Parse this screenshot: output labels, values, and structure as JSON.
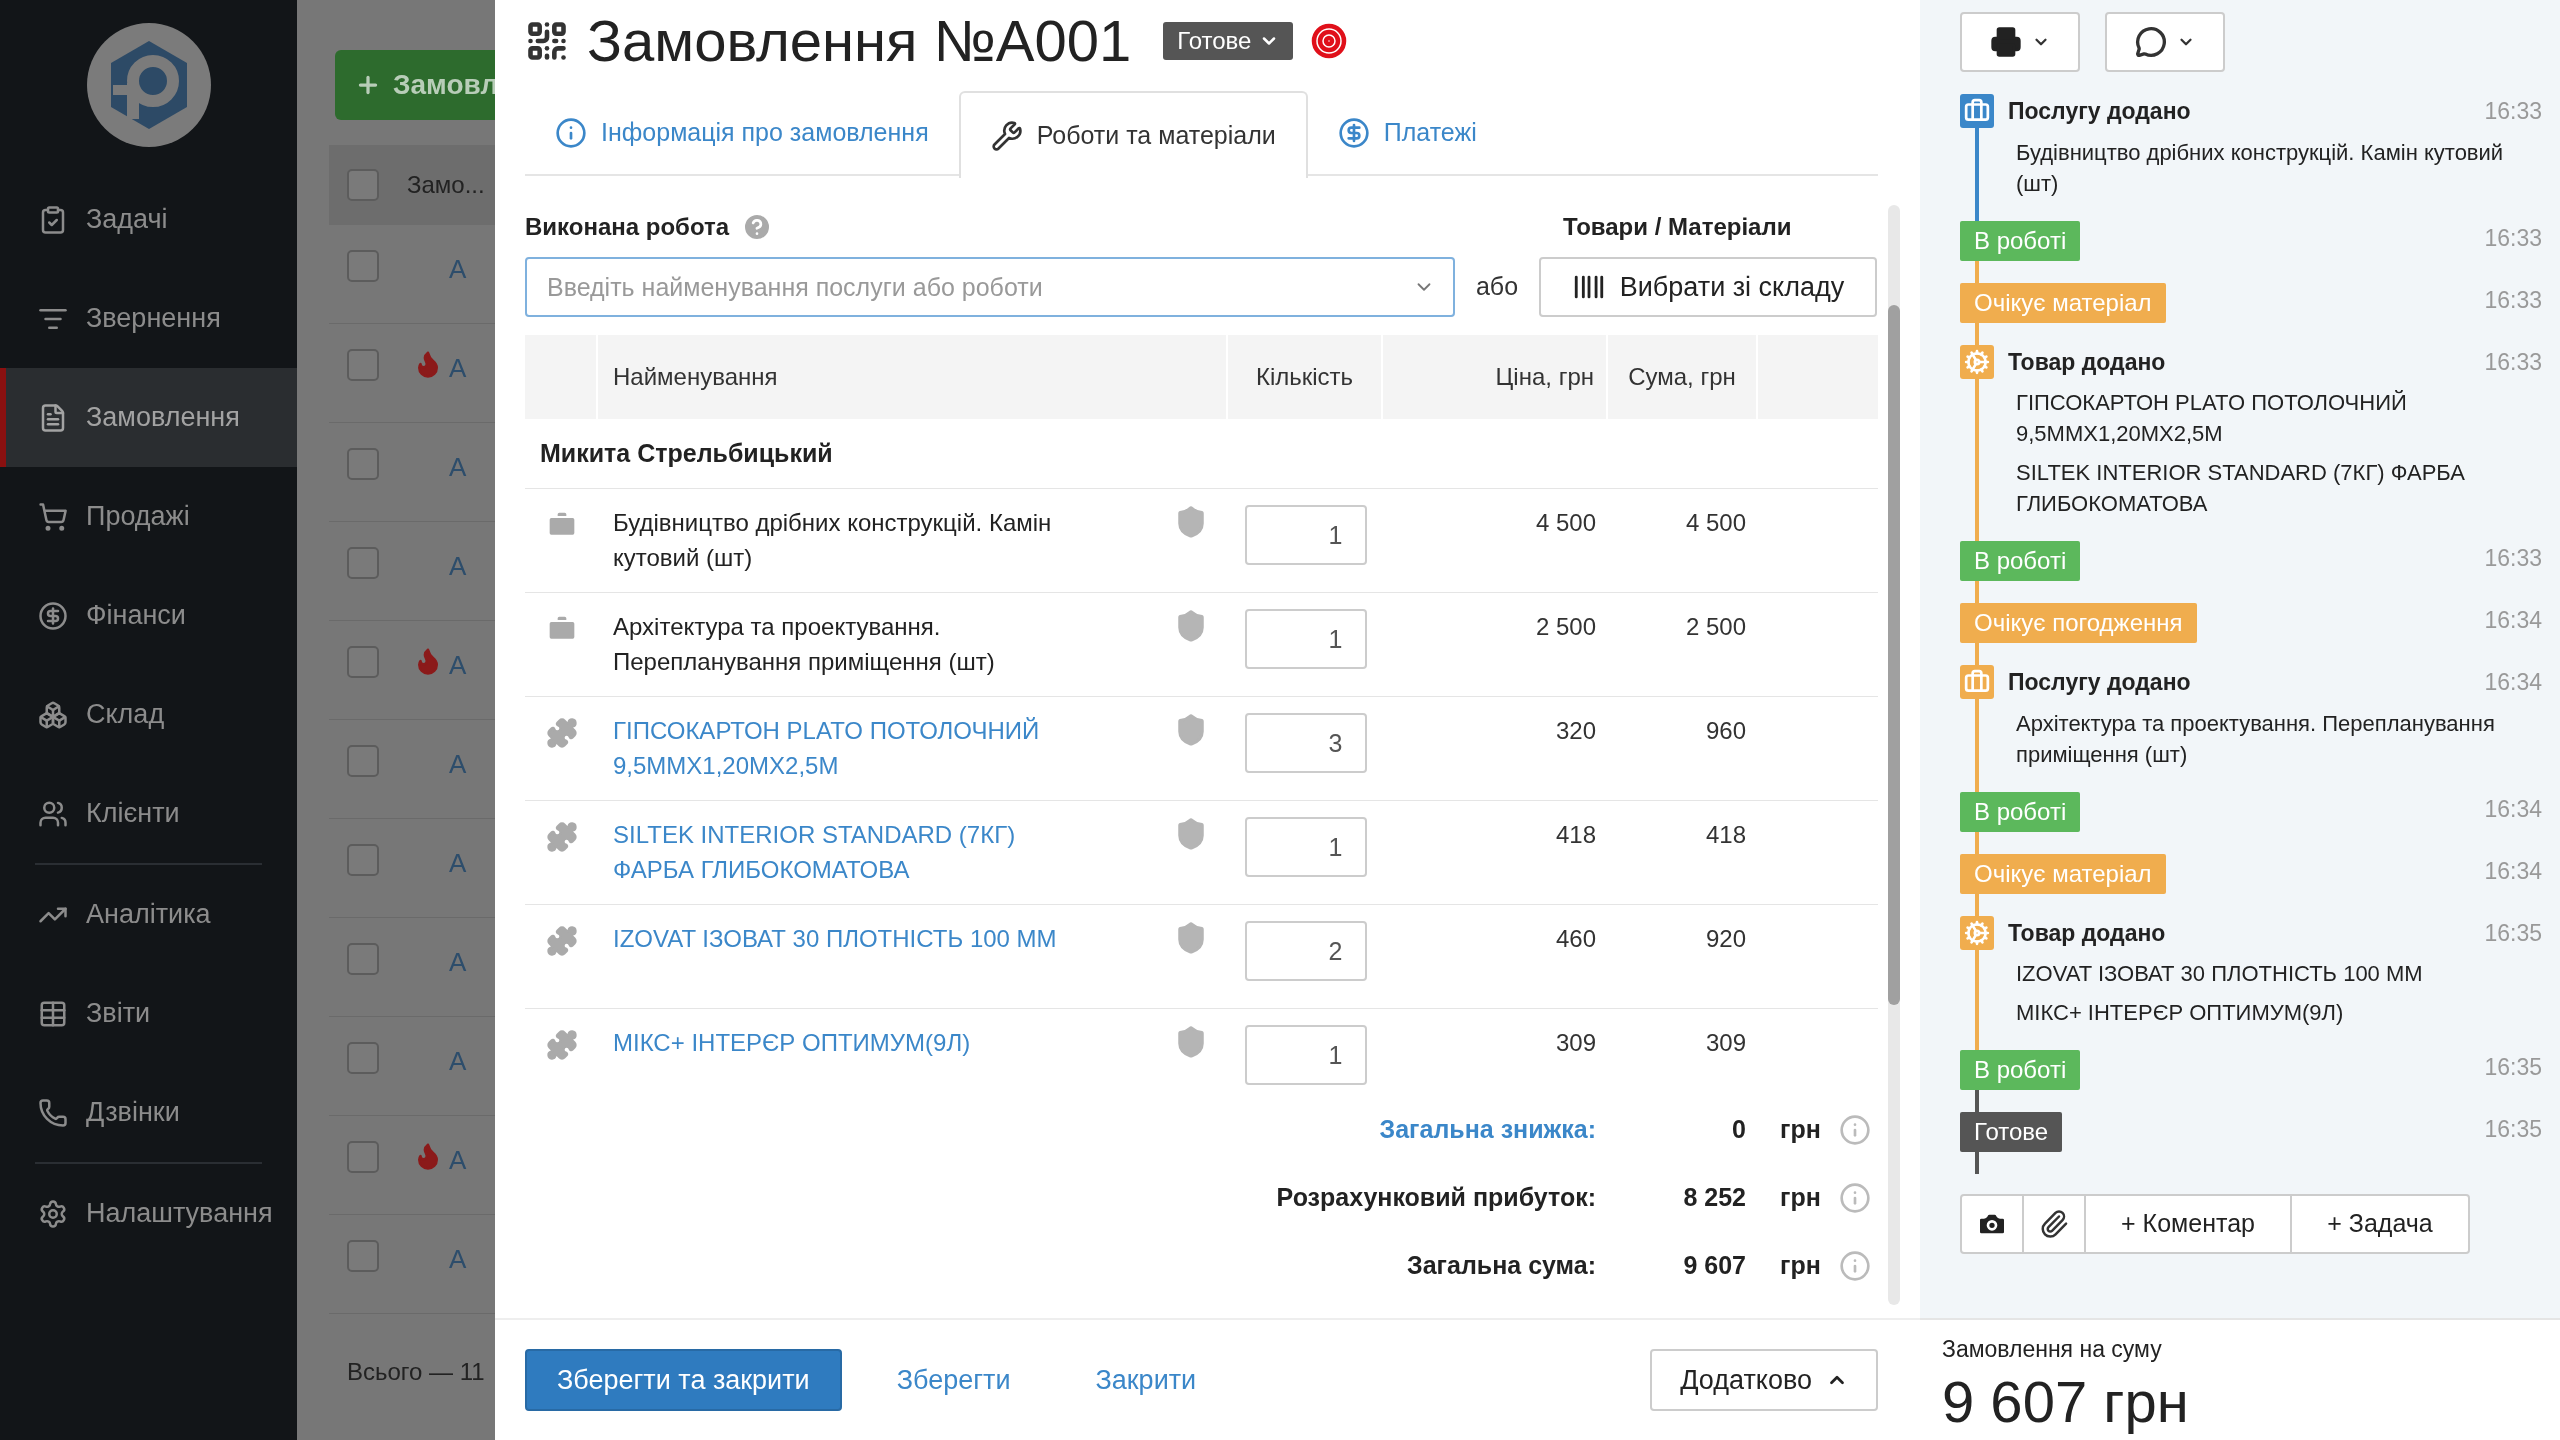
{
  "sidebar": {
    "groups": [
      [
        {
          "label": "Задачі",
          "selected": false
        },
        {
          "label": "Звернення",
          "selected": false
        },
        {
          "label": "Замовлення",
          "selected": true
        },
        {
          "label": "Продажі",
          "selected": false
        },
        {
          "label": "Фінанси",
          "selected": false
        },
        {
          "label": "Склад",
          "selected": false
        },
        {
          "label": "Клієнти",
          "selected": false
        }
      ],
      [
        {
          "label": "Аналітика",
          "selected": false
        },
        {
          "label": "Звіти",
          "selected": false
        },
        {
          "label": "Дзвінки",
          "selected": false
        }
      ],
      [
        {
          "label": "Налаштування",
          "selected": false
        }
      ]
    ]
  },
  "order_list": {
    "new_button": "Замовл",
    "header": "Замо...",
    "all_checked": false,
    "rows": [
      {
        "checked": false,
        "hot": false,
        "number": "A"
      },
      {
        "checked": false,
        "hot": true,
        "number": "A"
      },
      {
        "checked": false,
        "hot": false,
        "number": "A"
      },
      {
        "checked": false,
        "hot": false,
        "number": "A"
      },
      {
        "checked": false,
        "hot": true,
        "number": "A"
      },
      {
        "checked": false,
        "hot": false,
        "number": "A"
      },
      {
        "checked": false,
        "hot": false,
        "number": "A"
      },
      {
        "checked": false,
        "hot": false,
        "number": "A"
      },
      {
        "checked": false,
        "hot": false,
        "number": "A"
      },
      {
        "checked": false,
        "hot": true,
        "number": "A"
      },
      {
        "checked": false,
        "hot": false,
        "number": "A"
      }
    ],
    "footer": "Всього — 11"
  },
  "order": {
    "title": "Замовлення №A001",
    "status": "Готове",
    "tabs": [
      {
        "label": "Інформація про замовлення",
        "selected": false
      },
      {
        "label": "Роботи та матеріали",
        "selected": true
      },
      {
        "label": "Платежі",
        "selected": false
      }
    ],
    "work_label": "Виконана робота",
    "work_search": {
      "placeholder": "Введіть найменування послуги або роботи"
    },
    "or": "або",
    "materials_label": "Товари / Матеріали",
    "stock_button": "Вибрати зі складу",
    "table": {
      "columns": [
        "Найменування",
        "Кількість",
        "Ціна, грн",
        "Сума, грн"
      ],
      "group": "Микита Стрельбицький",
      "rows": [
        {
          "kind": "service",
          "name": "Будівництво дрібних конструкцій. Камін кутовий (шт)",
          "quantity": "1",
          "price": "4 500",
          "sum": "4 500"
        },
        {
          "kind": "service",
          "name": "Архітектура та проектування. Перепланування приміщення (шт)",
          "quantity": "1",
          "price": "2 500",
          "sum": "2 500"
        },
        {
          "kind": "product",
          "name": "ГІПСОКАРТОН PLATO ПОТОЛОЧНИЙ 9,5ММХ1,20МХ2,5М",
          "quantity": "3",
          "price": "320",
          "sum": "960"
        },
        {
          "kind": "product",
          "name": "SILTEK INTERIOR STANDARD (7КГ) ФАРБА ГЛИБОКОМАТОВА",
          "quantity": "1",
          "price": "418",
          "sum": "418"
        },
        {
          "kind": "product",
          "name": "IZOVAT ІЗОВАТ 30 ПЛОТНІСТЬ 100 ММ",
          "quantity": "2",
          "price": "460",
          "sum": "920"
        },
        {
          "kind": "product",
          "name": "МІКС+ ІНТЕРЄР ОПТИМУМ(9Л)",
          "quantity": "1",
          "price": "309",
          "sum": "309"
        }
      ]
    },
    "totals": [
      {
        "kind": "link",
        "label": "Загальна знижка:",
        "value": "0",
        "unit": "грн"
      },
      {
        "kind": "plain",
        "label": "Розрахунковий прибуток:",
        "value": "8 252",
        "unit": "грн"
      },
      {
        "kind": "plain",
        "label": "Загальна сума:",
        "value": "9 607",
        "unit": "грн"
      }
    ],
    "footer": {
      "save_close": "Зберегти та закрити",
      "save": "Зберегти",
      "close": "Закрити",
      "more": "Додатково"
    }
  },
  "history": {
    "events": [
      {
        "kind": "service",
        "color": "#3b87c9",
        "title": "Послугу додано",
        "time": "16:33",
        "lines": [
          "Будівництво дрібних конструкцій. Камін кутовий (шт)"
        ]
      },
      {
        "kind": "status",
        "color": "#5cb85c",
        "label": "В роботі",
        "time": "16:33"
      },
      {
        "kind": "status",
        "color": "#f0ad4e",
        "label": "Очікує матеріал",
        "time": "16:33"
      },
      {
        "kind": "product",
        "color": "#f0ad4e",
        "title": "Товар додано",
        "time": "16:33",
        "lines": [
          "ГІПСОКАРТОН PLATO ПОТОЛОЧНИЙ 9,5ММХ1,20МХ2,5М",
          "SILTEK INTERIOR STANDARD (7КГ) ФАРБА ГЛИБОКОМАТОВА"
        ]
      },
      {
        "kind": "status",
        "color": "#5cb85c",
        "label": "В роботі",
        "time": "16:33"
      },
      {
        "kind": "status",
        "color": "#f0ad4e",
        "label": "Очікує погодження",
        "time": "16:34"
      },
      {
        "kind": "service",
        "color": "#f0ad4e",
        "title": "Послугу додано",
        "time": "16:34",
        "lines": [
          "Архітектура та проектування. Перепланування приміщення (шт)"
        ]
      },
      {
        "kind": "status",
        "color": "#5cb85c",
        "label": "В роботі",
        "time": "16:34"
      },
      {
        "kind": "status",
        "color": "#f0ad4e",
        "label": "Очікує матеріал",
        "time": "16:34"
      },
      {
        "kind": "product",
        "color": "#f0ad4e",
        "title": "Товар додано",
        "time": "16:35",
        "lines": [
          "IZOVAT ІЗОВАТ 30 ПЛОТНІСТЬ 100 ММ",
          "МІКС+ ІНТЕРЄР ОПТИМУМ(9Л)"
        ]
      },
      {
        "kind": "status",
        "color": "#5cb85c",
        "label": "В роботі",
        "time": "16:35"
      },
      {
        "kind": "status",
        "color": "#555555",
        "label": "Готове",
        "time": "16:35"
      }
    ],
    "comment_button": "+ Коментар",
    "task_button": "+ Задача",
    "sum_label": "Замовлення на суму",
    "sum": "9 607 грн"
  }
}
